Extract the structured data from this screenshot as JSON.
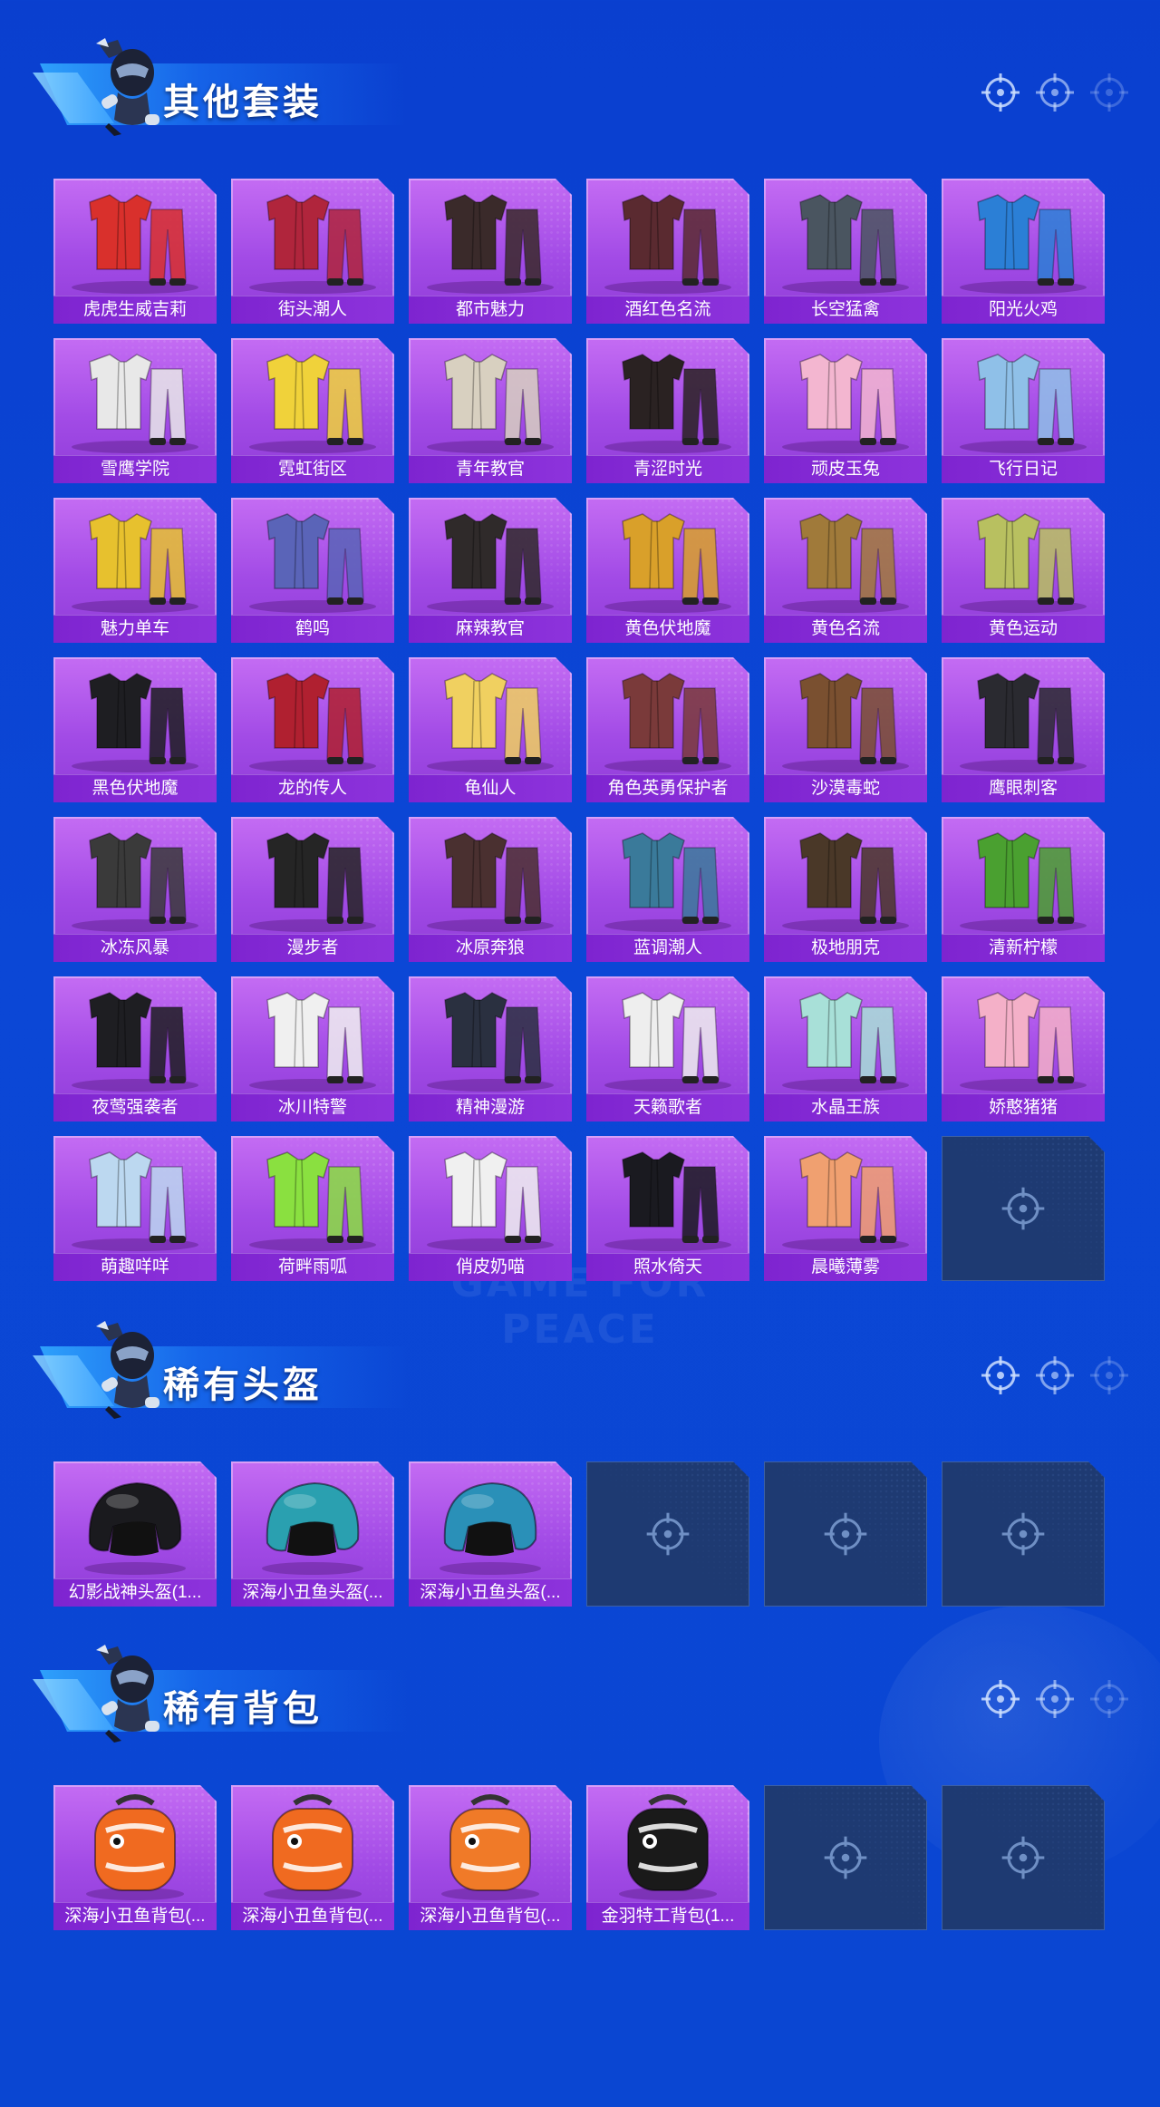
{
  "colors": {
    "background": "#0b47d6",
    "card_purple": "#a24be6",
    "card_label": "#7e24d0",
    "empty_slot": "#1e3a72"
  },
  "watermark": "GAME FOR PEACE",
  "sections": [
    {
      "title": "其他套装",
      "items": [
        {
          "label": "虎虎生威吉莉",
          "icon": "red-white-suit-icon",
          "color": "#d9302c"
        },
        {
          "label": "街头潮人",
          "icon": "red-jacket-outfit-icon",
          "color": "#b0253c"
        },
        {
          "label": "都市魅力",
          "icon": "plaid-outfit-icon",
          "color": "#3a2a2a"
        },
        {
          "label": "酒红色名流",
          "icon": "suit-outfit-icon",
          "color": "#5a2a30"
        },
        {
          "label": "长空猛禽",
          "icon": "camo-jacket-icon",
          "color": "#4a5560"
        },
        {
          "label": "阳光火鸡",
          "icon": "blue-yellow-outfit-icon",
          "color": "#2b7fd6"
        },
        {
          "label": "雪鹰学院",
          "icon": "school-uniform-icon",
          "color": "#e8e8e8"
        },
        {
          "label": "霓虹街区",
          "icon": "neon-outfit-icon",
          "color": "#f0d23a"
        },
        {
          "label": "青年教官",
          "icon": "instructor-outfit-icon",
          "color": "#d8d0c0"
        },
        {
          "label": "青涩时光",
          "icon": "dark-red-outfit-icon",
          "color": "#2a2222"
        },
        {
          "label": "顽皮玉兔",
          "icon": "bunny-outfit-icon",
          "color": "#f3b6d0"
        },
        {
          "label": "飞行日记",
          "icon": "flight-outfit-icon",
          "color": "#8fc0e8"
        },
        {
          "label": "魅力单车",
          "icon": "yellow-top-outfit-icon",
          "color": "#e7c12e"
        },
        {
          "label": "鹤鸣",
          "icon": "hoodie-icon",
          "color": "#5a64b8"
        },
        {
          "label": "麻辣教官",
          "icon": "dark-outfit-icon",
          "color": "#2f2a2a"
        },
        {
          "label": "黄色伏地魔",
          "icon": "yellow-hoodie-icon",
          "color": "#d9a02a"
        },
        {
          "label": "黄色名流",
          "icon": "brown-suit-icon",
          "color": "#a07a3a"
        },
        {
          "label": "黄色运动",
          "icon": "sport-jacket-icon",
          "color": "#b8c060"
        },
        {
          "label": "黑色伏地魔",
          "icon": "black-hoodie-icon",
          "color": "#1e1e22"
        },
        {
          "label": "龙的传人",
          "icon": "dragon-outfit-icon",
          "color": "#b02030"
        },
        {
          "label": "龟仙人",
          "icon": "hawaiian-shirt-icon",
          "color": "#f0d060"
        },
        {
          "label": "角色英勇保护者",
          "icon": "armor-suit-icon",
          "color": "#7a3a3a"
        },
        {
          "label": "沙漠毒蛇",
          "icon": "desert-outfit-icon",
          "color": "#7a5030"
        },
        {
          "label": "鹰眼刺客",
          "icon": "assassin-outfit-icon",
          "color": "#2a2a30"
        },
        {
          "label": "冰冻风暴",
          "icon": "tactical-outfit-icon",
          "color": "#3a3a3a"
        },
        {
          "label": "漫步者",
          "icon": "black-leather-icon",
          "color": "#252525"
        },
        {
          "label": "冰原奔狼",
          "icon": "wolf-armor-icon",
          "color": "#4a3030"
        },
        {
          "label": "蓝调潮人",
          "icon": "blue-mask-outfit-icon",
          "color": "#3a7a9a"
        },
        {
          "label": "极地朋克",
          "icon": "punk-outfit-icon",
          "color": "#4a3828"
        },
        {
          "label": "清新柠檬",
          "icon": "green-jacket-icon",
          "color": "#4aa030"
        },
        {
          "label": "夜莺强袭者",
          "icon": "black-jacket-icon",
          "color": "#1e1e22"
        },
        {
          "label": "冰川特警",
          "icon": "white-suit-icon",
          "color": "#f0f0f0"
        },
        {
          "label": "精神漫游",
          "icon": "diver-suit-icon",
          "color": "#2a3040"
        },
        {
          "label": "天籁歌者",
          "icon": "white-dress-icon",
          "color": "#eeeeee"
        },
        {
          "label": "水晶王族",
          "icon": "crystal-dress-icon",
          "color": "#a8e0d8"
        },
        {
          "label": "娇憨猪猪",
          "icon": "pink-pig-outfit-icon",
          "color": "#f4b0c8"
        },
        {
          "label": "萌趣咩咩",
          "icon": "sheep-outfit-icon",
          "color": "#bcd8f0"
        },
        {
          "label": "荷畔雨呱",
          "icon": "frog-outfit-icon",
          "color": "#8ae040"
        },
        {
          "label": "俏皮奶喵",
          "icon": "cat-outfit-icon",
          "color": "#f0f0f0"
        },
        {
          "label": "照水倚天",
          "icon": "black-gold-suit-icon",
          "color": "#1a1a20"
        },
        {
          "label": "晨曦薄雾",
          "icon": "peach-dress-icon",
          "color": "#f0a070"
        },
        {
          "label": "",
          "icon": "empty-slot-icon",
          "color": ""
        }
      ]
    },
    {
      "title": "稀有头盔",
      "items": [
        {
          "label": "幻影战神头盔(1...",
          "icon": "black-helmet-icon",
          "color": "#1a1a1e"
        },
        {
          "label": "深海小丑鱼头盔(...",
          "icon": "clownfish-helmet-icon",
          "color": "#2aa0b0"
        },
        {
          "label": "深海小丑鱼头盔(...",
          "icon": "clownfish-helmet-icon",
          "color": "#2a90b8"
        },
        {
          "label": "",
          "icon": "empty-slot-icon",
          "color": ""
        },
        {
          "label": "",
          "icon": "empty-slot-icon",
          "color": ""
        },
        {
          "label": "",
          "icon": "empty-slot-icon",
          "color": ""
        }
      ]
    },
    {
      "title": "稀有背包",
      "items": [
        {
          "label": "深海小丑鱼背包(...",
          "icon": "clownfish-backpack-icon",
          "color": "#f06a20"
        },
        {
          "label": "深海小丑鱼背包(...",
          "icon": "clownfish-backpack-icon",
          "color": "#f06a20"
        },
        {
          "label": "深海小丑鱼背包(...",
          "icon": "clownfish-backpack-icon",
          "color": "#f07a28"
        },
        {
          "label": "金羽特工背包(1...",
          "icon": "black-gold-backpack-icon",
          "color": "#1a1a1a"
        },
        {
          "label": "",
          "icon": "empty-slot-icon",
          "color": ""
        },
        {
          "label": "",
          "icon": "empty-slot-icon",
          "color": ""
        }
      ]
    }
  ]
}
